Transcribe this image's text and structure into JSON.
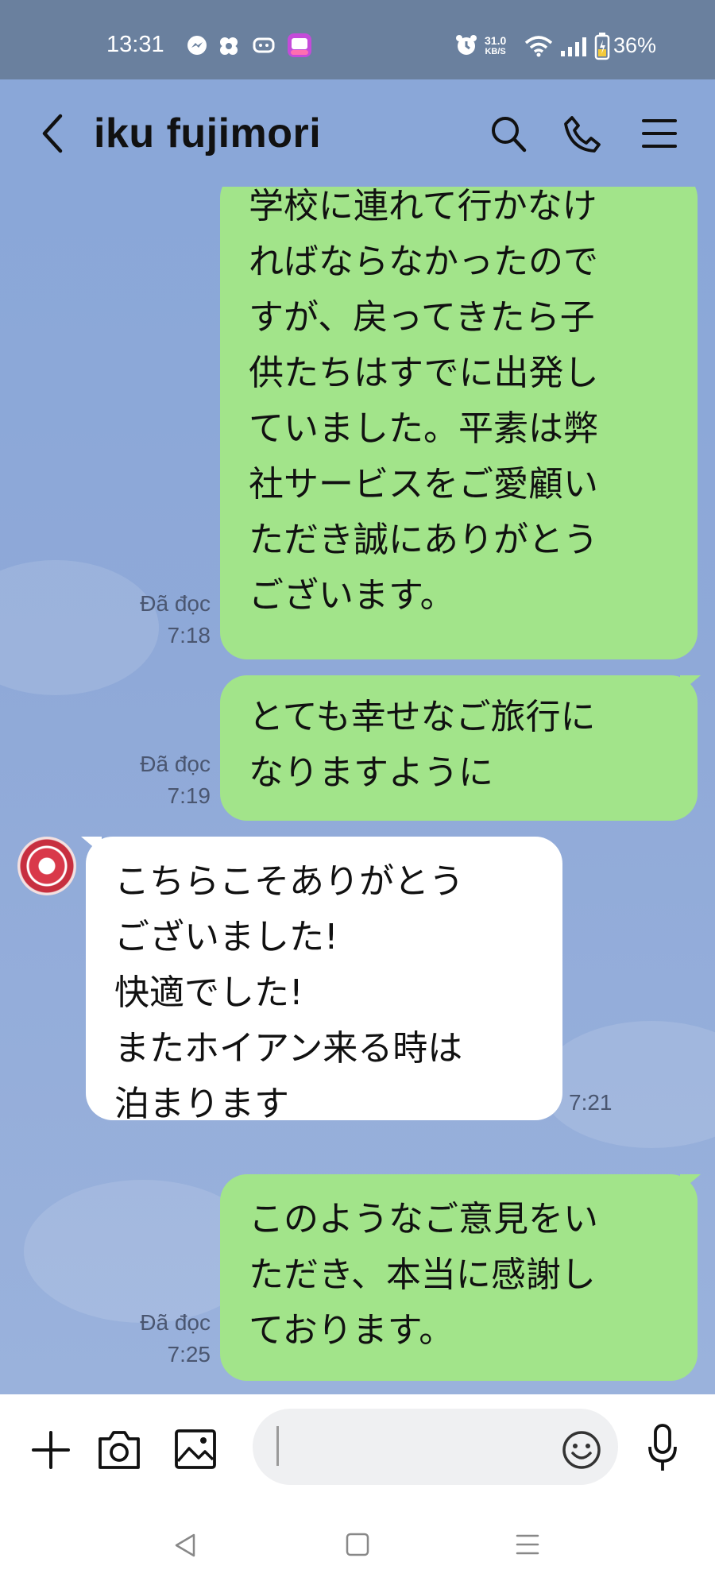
{
  "status_bar": {
    "time": "13:31",
    "net_speed_value": "31.0",
    "net_speed_unit": "KB/S",
    "battery": "36%",
    "icons": [
      "messenger-icon",
      "pinwheel-icon",
      "game-icon",
      "app-badge-icon",
      "alarm-icon",
      "wifi-icon",
      "signal-icon",
      "battery-icon"
    ]
  },
  "header": {
    "title": "iku fujimori",
    "icons": [
      "back-icon",
      "search-icon",
      "phone-icon",
      "menu-icon"
    ]
  },
  "messages": [
    {
      "id": "m1",
      "direction": "out",
      "text": "学校に連れて行かなけ\nればならなかったので\nすが、戻ってきたら子\n供たちはすでに出発し\nていました。平素は弊\n社サービスをご愛顧い\nただき誠にありがとう\nございます。",
      "read": "Đã đọc",
      "time": "7:18"
    },
    {
      "id": "m2",
      "direction": "out",
      "text": "とても幸せなご旅行に\nなりますように",
      "read": "Đã đọc",
      "time": "7:19"
    },
    {
      "id": "m3",
      "direction": "in",
      "text": "こちらこそありがとう\nございました!\n快適でした!\nまたホイアン来る時は\n泊まります",
      "read": "",
      "time": "7:21"
    },
    {
      "id": "m4",
      "direction": "out",
      "text": "このようなご意見をい\nただき、本当に感謝し\nております。",
      "read": "Đã đọc",
      "time": "7:25"
    }
  ],
  "input_bar": {
    "placeholder": "",
    "icons": [
      "plus-icon",
      "camera-icon",
      "image-icon",
      "emoji-icon",
      "mic-icon"
    ]
  },
  "nav_bar": {
    "icons": [
      "nav-back-icon",
      "nav-home-icon",
      "nav-recents-icon"
    ]
  }
}
